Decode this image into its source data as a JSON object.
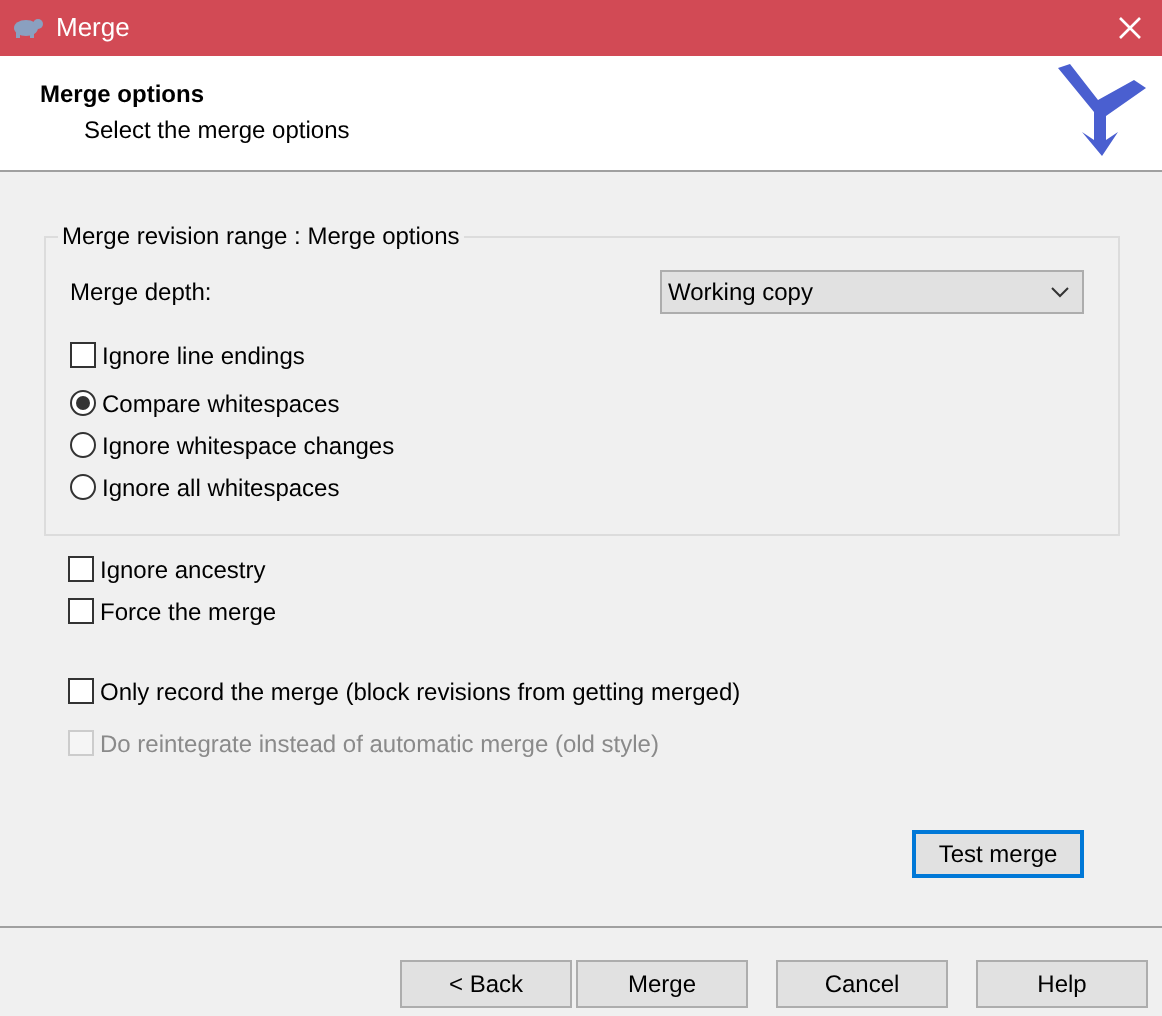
{
  "window": {
    "title": "Merge"
  },
  "header": {
    "title": "Merge options",
    "subtitle": "Select the merge options"
  },
  "group": {
    "legend": "Merge revision range : Merge options",
    "depth_label": "Merge depth:",
    "depth_value": "Working copy",
    "options": [
      {
        "kind": "checkbox",
        "label": "Ignore line endings",
        "checked": false,
        "disabled": false
      },
      {
        "kind": "radio",
        "label": "Compare whitespaces",
        "selected": true,
        "disabled": false
      },
      {
        "kind": "radio",
        "label": "Ignore whitespace changes",
        "selected": false,
        "disabled": false
      },
      {
        "kind": "radio",
        "label": "Ignore all whitespaces",
        "selected": false,
        "disabled": false
      }
    ]
  },
  "options": [
    {
      "label": "Ignore ancestry",
      "checked": false,
      "disabled": false
    },
    {
      "label": "Force the merge",
      "checked": false,
      "disabled": false
    }
  ],
  "record_options": [
    {
      "label": "Only record the merge (block revisions from getting merged)",
      "checked": false,
      "disabled": false
    },
    {
      "label": "Do reintegrate instead of automatic merge (old style)",
      "checked": false,
      "disabled": true
    }
  ],
  "test_button": {
    "label": "Test merge",
    "focused": true
  },
  "buttons": [
    {
      "label": "< Back",
      "focused": false
    },
    {
      "label": "Merge",
      "focused": false
    },
    {
      "label": "Cancel",
      "focused": false
    },
    {
      "label": "Help",
      "focused": false
    }
  ]
}
